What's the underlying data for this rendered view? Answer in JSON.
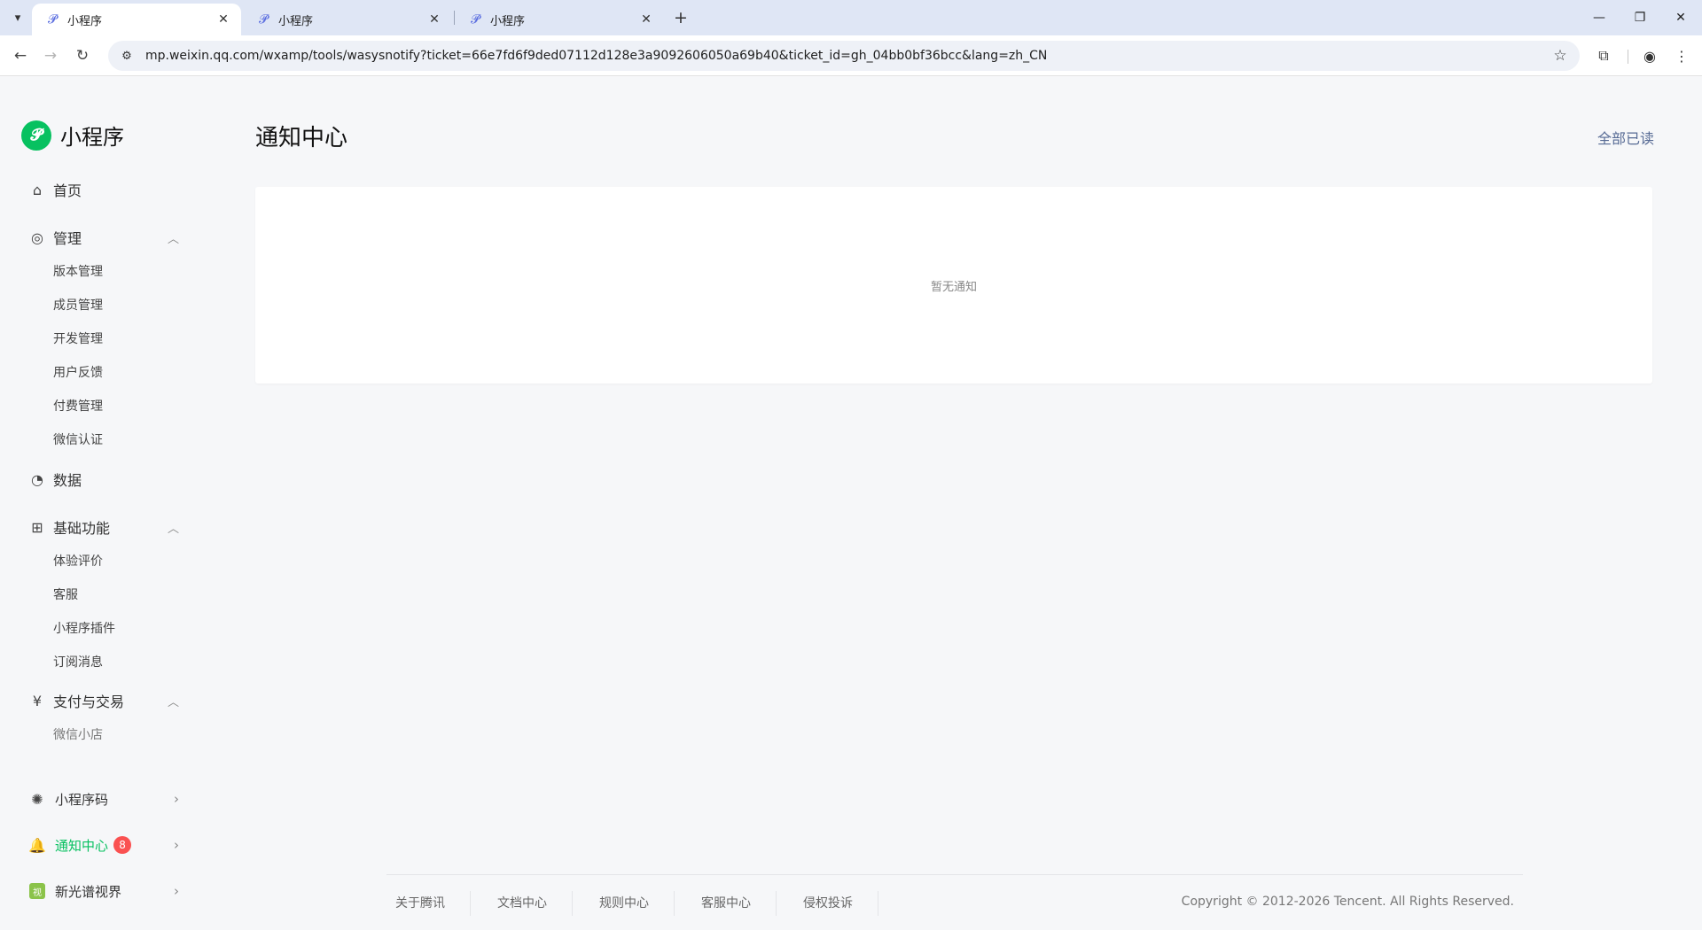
{
  "browser": {
    "tabs": [
      {
        "label": "小程序",
        "active": true
      },
      {
        "label": "小程序",
        "active": false
      },
      {
        "label": "小程序",
        "active": false
      }
    ],
    "url": "mp.weixin.qq.com/wxamp/tools/wasysnotify?ticket=66e7fd6f9ded07112d128e3a9092606050a69b40&ticket_id=gh_04bb0bf36bcc&lang=zh_CN",
    "icons": {
      "tab_search": "▾",
      "favicon": "𝓟",
      "close": "✕",
      "new_tab": "+",
      "minimize": "—",
      "restore": "❐",
      "window_close": "✕",
      "back": "←",
      "forward": "→",
      "reload": "↻",
      "site_info": "⚙",
      "star": "☆",
      "extensions": "⧉",
      "profile": "◉",
      "menu": "⋮"
    }
  },
  "brand": {
    "name": "小程序",
    "logo_glyph": "𝓟"
  },
  "sidebar": {
    "home": {
      "label": "首页",
      "icon": "⌂"
    },
    "manage": {
      "label": "管理",
      "icon": "◎",
      "chevron": "︿",
      "items": [
        "版本管理",
        "成员管理",
        "开发管理",
        "用户反馈",
        "付费管理",
        "微信认证"
      ]
    },
    "data": {
      "label": "数据",
      "icon": "◔"
    },
    "basic": {
      "label": "基础功能",
      "icon": "⊞",
      "chevron": "︿",
      "items": [
        "体验评价",
        "客服",
        "小程序插件",
        "订阅消息"
      ]
    },
    "pay": {
      "label": "支付与交易",
      "icon": "¥",
      "chevron": "︿",
      "items": [
        "微信小店"
      ]
    },
    "qrcode": {
      "label": "小程序码",
      "icon": "✺",
      "chevron": "›"
    },
    "notify": {
      "label": "通知中心",
      "icon": "🔔",
      "badge": "8",
      "chevron": "›"
    },
    "account": {
      "label": "新光谱视界",
      "thumb": "视",
      "chevron": "›"
    }
  },
  "main": {
    "title": "通知中心",
    "mark_all_read": "全部已读",
    "empty_text": "暂无通知"
  },
  "footer": {
    "links": [
      "关于腾讯",
      "文档中心",
      "规则中心",
      "客服中心",
      "侵权投诉"
    ],
    "copyright": "Copyright © 2012-2026 Tencent. All Rights Reserved."
  },
  "colors": {
    "brand_green": "#07c160",
    "link_blue": "#576b95",
    "badge_red": "#fa5151",
    "tabbar_bg": "#dfe6f5",
    "page_bg": "#f6f7f9"
  }
}
